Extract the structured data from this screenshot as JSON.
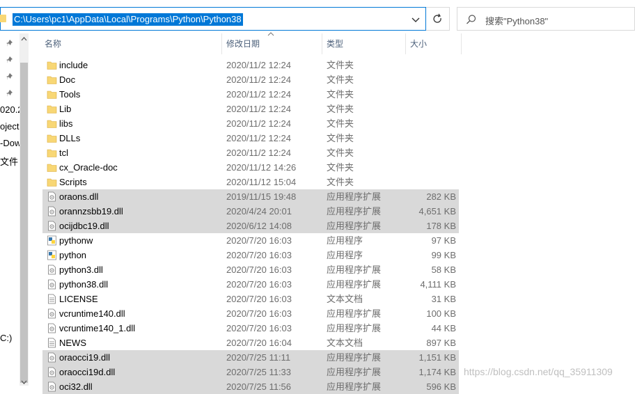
{
  "address": {
    "path": "C:\\Users\\pc1\\AppData\\Local\\Programs\\Python\\Python38"
  },
  "search": {
    "placeholder": "搜索\"Python38\""
  },
  "nav": {
    "items": [
      "020.2",
      "oject",
      "-Dow",
      "文件",
      "C:)"
    ]
  },
  "columns": {
    "name": "名称",
    "date": "修改日期",
    "type": "类型",
    "size": "大小"
  },
  "colors": {
    "selection": "#d9d9d9",
    "accent": "#0078d7",
    "folder": "#f8d775"
  },
  "files": [
    {
      "name": "include",
      "date": "2020/11/2 12:24",
      "type": "文件夹",
      "size": "",
      "icon": "folder-icon",
      "selected": false
    },
    {
      "name": "Doc",
      "date": "2020/11/2 12:24",
      "type": "文件夹",
      "size": "",
      "icon": "folder-icon",
      "selected": false
    },
    {
      "name": "Tools",
      "date": "2020/11/2 12:24",
      "type": "文件夹",
      "size": "",
      "icon": "folder-icon",
      "selected": false
    },
    {
      "name": "Lib",
      "date": "2020/11/2 12:24",
      "type": "文件夹",
      "size": "",
      "icon": "folder-icon",
      "selected": false
    },
    {
      "name": "libs",
      "date": "2020/11/2 12:24",
      "type": "文件夹",
      "size": "",
      "icon": "folder-icon",
      "selected": false
    },
    {
      "name": "DLLs",
      "date": "2020/11/2 12:24",
      "type": "文件夹",
      "size": "",
      "icon": "folder-icon",
      "selected": false
    },
    {
      "name": "tcl",
      "date": "2020/11/2 12:24",
      "type": "文件夹",
      "size": "",
      "icon": "folder-icon",
      "selected": false
    },
    {
      "name": "cx_Oracle-doc",
      "date": "2020/11/12 14:26",
      "type": "文件夹",
      "size": "",
      "icon": "folder-icon",
      "selected": false
    },
    {
      "name": "Scripts",
      "date": "2020/11/12 15:04",
      "type": "文件夹",
      "size": "",
      "icon": "folder-icon",
      "selected": false
    },
    {
      "name": "oraons.dll",
      "date": "2019/11/15 19:48",
      "type": "应用程序扩展",
      "size": "282 KB",
      "icon": "dll-file-icon",
      "selected": true
    },
    {
      "name": "orannzsbb19.dll",
      "date": "2020/4/24 20:01",
      "type": "应用程序扩展",
      "size": "4,651 KB",
      "icon": "dll-file-icon",
      "selected": true
    },
    {
      "name": "ocijdbc19.dll",
      "date": "2020/6/12 14:08",
      "type": "应用程序扩展",
      "size": "178 KB",
      "icon": "dll-file-icon",
      "selected": true
    },
    {
      "name": "pythonw",
      "date": "2020/7/20 16:03",
      "type": "应用程序",
      "size": "97 KB",
      "icon": "python-app-icon",
      "selected": false
    },
    {
      "name": "python",
      "date": "2020/7/20 16:03",
      "type": "应用程序",
      "size": "99 KB",
      "icon": "python-app-icon",
      "selected": false
    },
    {
      "name": "python3.dll",
      "date": "2020/7/20 16:03",
      "type": "应用程序扩展",
      "size": "58 KB",
      "icon": "dll-file-icon",
      "selected": false
    },
    {
      "name": "python38.dll",
      "date": "2020/7/20 16:03",
      "type": "应用程序扩展",
      "size": "4,111 KB",
      "icon": "dll-file-icon",
      "selected": false
    },
    {
      "name": "LICENSE",
      "date": "2020/7/20 16:03",
      "type": "文本文档",
      "size": "31 KB",
      "icon": "text-file-icon",
      "selected": false
    },
    {
      "name": "vcruntime140.dll",
      "date": "2020/7/20 16:03",
      "type": "应用程序扩展",
      "size": "100 KB",
      "icon": "dll-file-icon",
      "selected": false
    },
    {
      "name": "vcruntime140_1.dll",
      "date": "2020/7/20 16:03",
      "type": "应用程序扩展",
      "size": "44 KB",
      "icon": "dll-file-icon",
      "selected": false
    },
    {
      "name": "NEWS",
      "date": "2020/7/20 16:04",
      "type": "文本文档",
      "size": "897 KB",
      "icon": "text-file-icon",
      "selected": false
    },
    {
      "name": "oraocci19.dll",
      "date": "2020/7/25 11:11",
      "type": "应用程序扩展",
      "size": "1,151 KB",
      "icon": "dll-file-icon",
      "selected": true
    },
    {
      "name": "oraocci19d.dll",
      "date": "2020/7/25 11:33",
      "type": "应用程序扩展",
      "size": "1,174 KB",
      "icon": "dll-file-icon",
      "selected": true
    },
    {
      "name": "oci32.dll",
      "date": "2020/7/25 11:56",
      "type": "应用程序扩展",
      "size": "596 KB",
      "icon": "dll-file-icon",
      "selected": true
    }
  ],
  "watermark": "https://blog.csdn.net/qq_35911309"
}
